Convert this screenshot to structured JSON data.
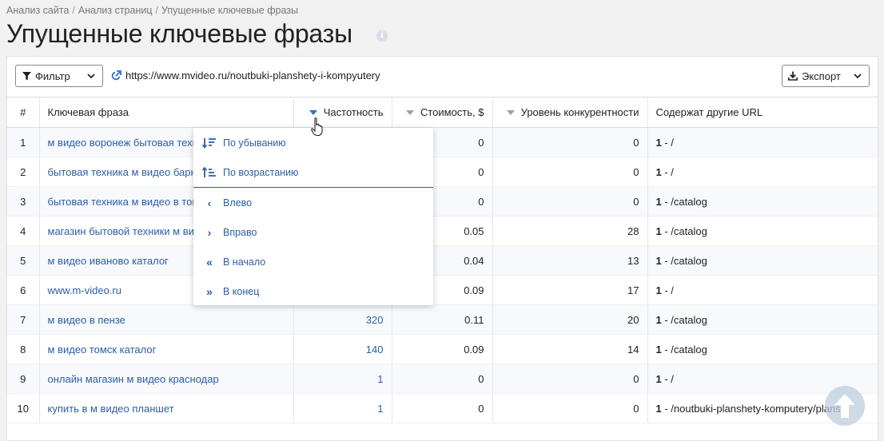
{
  "breadcrumb": [
    "Анализ сайта",
    "Анализ страниц",
    "Упущенные ключевые фразы"
  ],
  "page": {
    "title": "Упущенные ключевые фразы"
  },
  "toolbar": {
    "filter_label": "Фильтр",
    "url": "https://www.mvideo.ru/noutbuki-planshety-i-kompyutery",
    "export_label": "Экспорт"
  },
  "table": {
    "headers": {
      "num": "#",
      "phrase": "Ключевая фраза",
      "freq": "Частотность",
      "cost": "Стоимость, $",
      "competition": "Уровень конкурентности",
      "other_urls": "Содержат другие URL"
    },
    "rows": [
      {
        "num": "1",
        "phrase": "м видео воронеж бытовая техника",
        "freq": "",
        "cost": "0",
        "competition": "0",
        "url_count": "1",
        "url_path": " - /"
      },
      {
        "num": "2",
        "phrase": "бытовая техника м видео барнаул",
        "freq": "",
        "cost": "0",
        "competition": "0",
        "url_count": "1",
        "url_path": " - /"
      },
      {
        "num": "3",
        "phrase": "бытовая техника м видео в томске",
        "freq": "",
        "cost": "0",
        "competition": "0",
        "url_count": "1",
        "url_path": " - /catalog"
      },
      {
        "num": "4",
        "phrase": "магазин бытовой техники м видео",
        "freq": "",
        "cost": "0.05",
        "competition": "28",
        "url_count": "1",
        "url_path": " - /catalog"
      },
      {
        "num": "5",
        "phrase": "м видео иваново каталог",
        "freq": "",
        "cost": "0.04",
        "competition": "13",
        "url_count": "1",
        "url_path": " - /catalog"
      },
      {
        "num": "6",
        "phrase": "www.m-video.ru",
        "freq": "",
        "cost": "0.09",
        "competition": "17",
        "url_count": "1",
        "url_path": " - /"
      },
      {
        "num": "7",
        "phrase": "м видео в пензе",
        "freq": "320",
        "cost": "0.11",
        "competition": "20",
        "url_count": "1",
        "url_path": " - /catalog"
      },
      {
        "num": "8",
        "phrase": "м видео томск каталог",
        "freq": "140",
        "cost": "0.09",
        "competition": "14",
        "url_count": "1",
        "url_path": " - /catalog"
      },
      {
        "num": "9",
        "phrase": "онлайн магазин м видео краснодар",
        "freq": "1",
        "cost": "0",
        "competition": "0",
        "url_count": "1",
        "url_path": " - /"
      },
      {
        "num": "10",
        "phrase": "купить в м видео планшет",
        "freq": "1",
        "cost": "0",
        "competition": "0",
        "url_count": "1",
        "url_path": " - /noutbuki-planshety-komputery/plans"
      }
    ]
  },
  "sort_menu": {
    "desc": "По убыванию",
    "asc": "По возрастанию",
    "left": "Влево",
    "right": "Вправо",
    "to_start": "В начало",
    "to_end": "В конец"
  },
  "colors": {
    "link": "#2d5da8",
    "accent": "#2d6fc9",
    "zebra": "#f7f9fc"
  }
}
